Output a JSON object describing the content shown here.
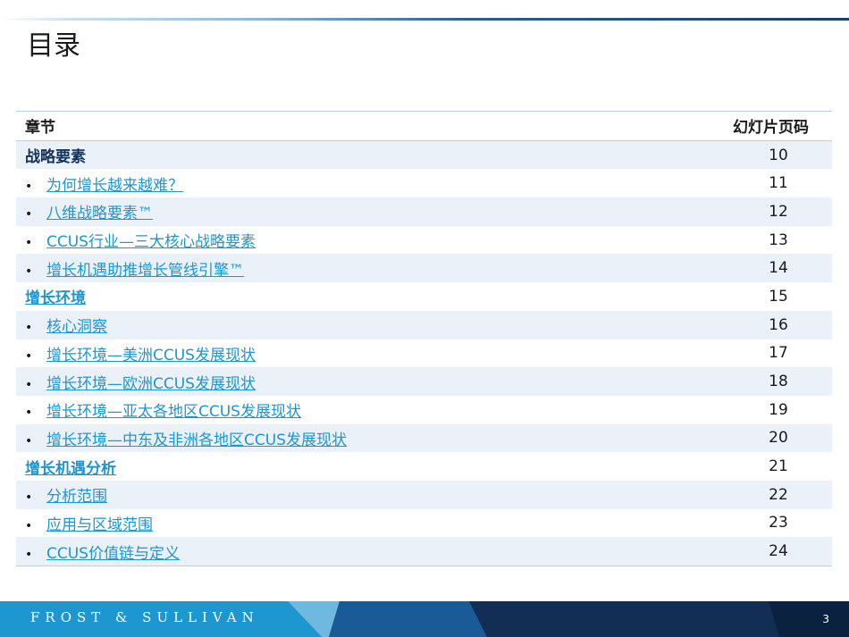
{
  "slide": {
    "title": "目录",
    "page_number": "3"
  },
  "table": {
    "headers": {
      "section": "章节",
      "page": "幻灯片页码"
    },
    "rows": [
      {
        "kind": "section",
        "style": "plain",
        "label": "战略要素",
        "page": "10"
      },
      {
        "kind": "item",
        "label": "为何增长越来越难？",
        "page": "11"
      },
      {
        "kind": "item",
        "label": "八维战略要素™",
        "page": "12"
      },
      {
        "kind": "item",
        "label": "CCUS行业—三大核心战略要素",
        "page": "13"
      },
      {
        "kind": "item",
        "label": "增长机遇助推增长管线引擎™",
        "page": "14"
      },
      {
        "kind": "section",
        "style": "link",
        "label": "增长环境",
        "page": "15"
      },
      {
        "kind": "item",
        "label": "核心洞察",
        "page": "16"
      },
      {
        "kind": "item",
        "label": "增长环境—美洲CCUS发展现状",
        "page": "17"
      },
      {
        "kind": "item",
        "label": "增长环境—欧洲CCUS发展现状",
        "page": "18"
      },
      {
        "kind": "item",
        "label": "增长环境—亚太各地区CCUS发展现状",
        "page": "19"
      },
      {
        "kind": "item",
        "label": "增长环境—中东及非洲各地区CCUS发展现状",
        "page": "20"
      },
      {
        "kind": "section",
        "style": "link",
        "label": "增长机遇分析",
        "page": "21"
      },
      {
        "kind": "item",
        "label": "分析范围",
        "page": "22"
      },
      {
        "kind": "item",
        "label": "应用与区域范围",
        "page": "23"
      },
      {
        "kind": "item",
        "label": "CCUS价值链与定义",
        "page": "24"
      }
    ],
    "bullet_char": "•"
  },
  "footer": {
    "brand": "FROST & SULLIVAN",
    "colors": {
      "light_blue": "#1e96d0",
      "mid_blue": "#1a5a96",
      "navy": "#0f2f57",
      "dark": "#0a2240"
    }
  }
}
